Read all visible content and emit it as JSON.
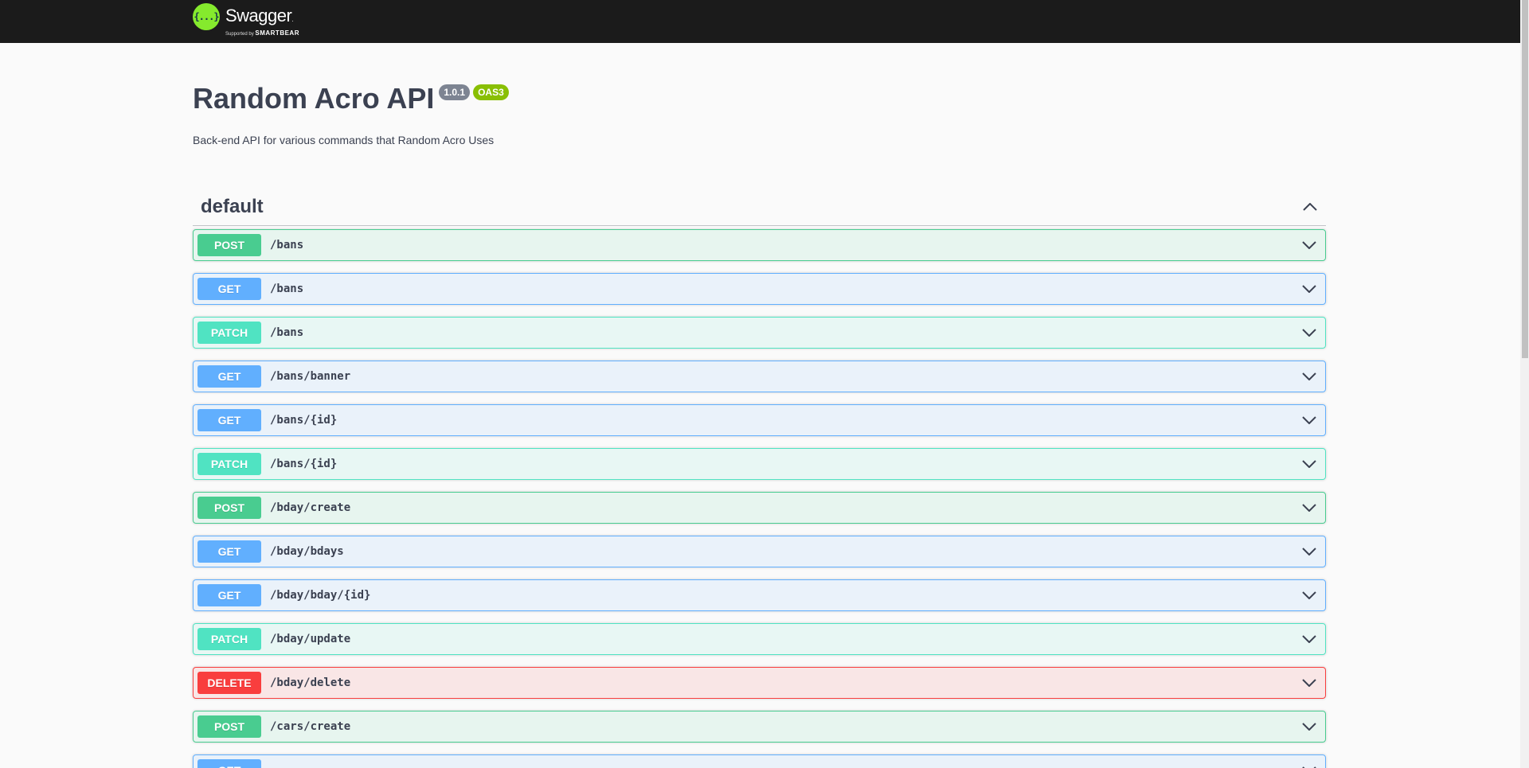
{
  "topbar": {
    "logo_glyph": "{...}",
    "brand_name": "Swagger",
    "brand_tm": ".",
    "brand_sub_prefix": "Supported by",
    "brand_sub_company": "SMARTBEAR"
  },
  "info": {
    "title": "Random Acro API",
    "version": "1.0.1",
    "spec": "OAS3",
    "description": "Back-end API for various commands that Random Acro Uses"
  },
  "tag": {
    "name": "default",
    "toggle_icon": "chevron-up-icon"
  },
  "operations": [
    {
      "method": "POST",
      "path": "/bans"
    },
    {
      "method": "GET",
      "path": "/bans"
    },
    {
      "method": "PATCH",
      "path": "/bans"
    },
    {
      "method": "GET",
      "path": "/bans/banner"
    },
    {
      "method": "GET",
      "path": "/bans/{id}"
    },
    {
      "method": "PATCH",
      "path": "/bans/{id}"
    },
    {
      "method": "POST",
      "path": "/bday/create"
    },
    {
      "method": "GET",
      "path": "/bday/bdays"
    },
    {
      "method": "GET",
      "path": "/bday/bday/{id}"
    },
    {
      "method": "PATCH",
      "path": "/bday/update"
    },
    {
      "method": "DELETE",
      "path": "/bday/delete"
    },
    {
      "method": "POST",
      "path": "/cars/create"
    },
    {
      "method": "GET",
      "path": ""
    }
  ],
  "colors": {
    "POST": "#49cc90",
    "GET": "#61affe",
    "PATCH": "#50e3c2",
    "DELETE": "#f93e3e",
    "topbar": "#1b1b1b",
    "logo": "#85ea2d"
  }
}
